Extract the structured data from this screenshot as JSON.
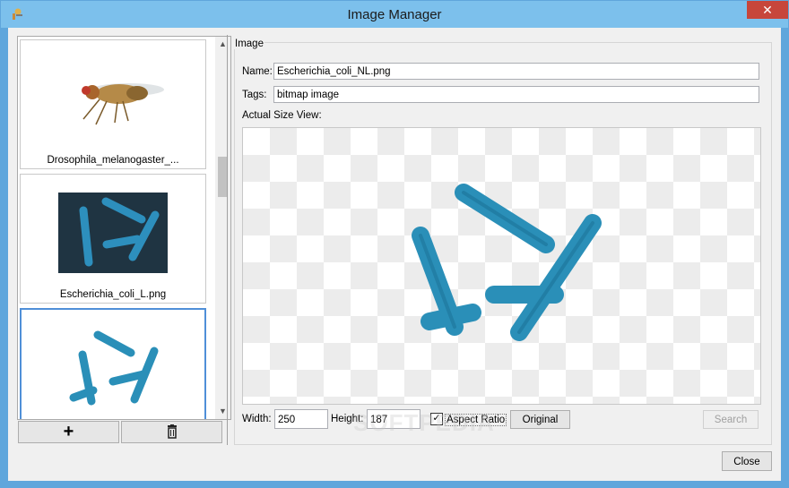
{
  "window": {
    "title": "Image Manager",
    "close_glyph": "✕",
    "app_icon": "tool-icon"
  },
  "thumbnails": [
    {
      "caption": "Drosophila_melanogaster_...",
      "selected": false
    },
    {
      "caption": "Escherichia_coli_L.png",
      "selected": false
    },
    {
      "caption": "",
      "selected": true
    }
  ],
  "list_buttons": {
    "add_glyph": "+",
    "delete_icon": "trash-icon"
  },
  "group": {
    "title": "Image"
  },
  "form": {
    "name_label": "Name:",
    "name_value": "Escherichia_coli_NL.png",
    "tags_label": "Tags:",
    "tags_value": "bitmap image",
    "view_label": "Actual Size View:",
    "width_label": "Width:",
    "width_value": "250",
    "height_label": "Height:",
    "height_value": "187",
    "aspect_label": "Aspect Ratio",
    "aspect_checked": true,
    "original_label": "Original",
    "search_label": "Search",
    "close_label": "Close"
  },
  "watermark": "SOFTPEDIA",
  "colors": {
    "accent": "#7cc0ec",
    "bacteria": "#2a8fb8",
    "selection": "#4f8fd8"
  }
}
